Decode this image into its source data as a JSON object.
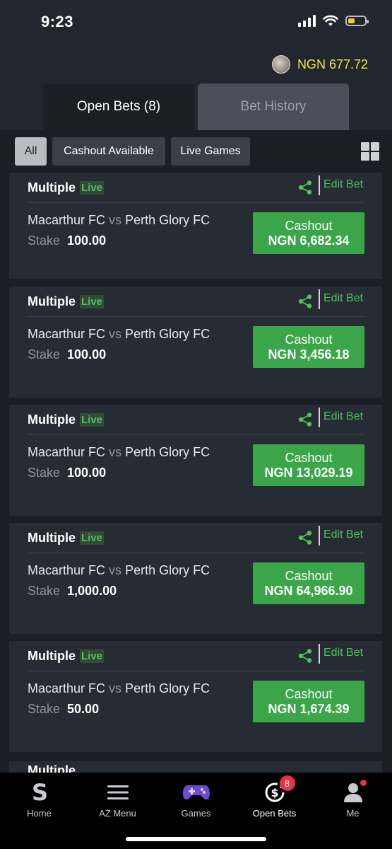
{
  "status": {
    "time": "9:23"
  },
  "header": {
    "balance": "NGN 677.72",
    "tabs": {
      "open_bets": "Open Bets (8)",
      "bet_history": "Bet History"
    }
  },
  "filters": {
    "all": "All",
    "cashout_available": "Cashout Available",
    "live_games": "Live Games"
  },
  "bets": [
    {
      "type": "Multiple",
      "live": "Live",
      "edit": "Edit Bet",
      "home": "Macarthur FC",
      "vs": "vs",
      "away": "Perth Glory FC",
      "stake_label": "Stake",
      "stake": "100.00",
      "cashout_label": "Cashout",
      "cashout_amount": "NGN 6,682.34"
    },
    {
      "type": "Multiple",
      "live": "Live",
      "edit": "Edit Bet",
      "home": "Macarthur FC",
      "vs": "vs",
      "away": "Perth Glory FC",
      "stake_label": "Stake",
      "stake": "100.00",
      "cashout_label": "Cashout",
      "cashout_amount": "NGN 3,456.18"
    },
    {
      "type": "Multiple",
      "live": "Live",
      "edit": "Edit Bet",
      "home": "Macarthur FC",
      "vs": "vs",
      "away": "Perth Glory FC",
      "stake_label": "Stake",
      "stake": "100.00",
      "cashout_label": "Cashout",
      "cashout_amount": "NGN 13,029.19"
    },
    {
      "type": "Multiple",
      "live": "Live",
      "edit": "Edit Bet",
      "home": "Macarthur FC",
      "vs": "vs",
      "away": "Perth Glory FC",
      "stake_label": "Stake",
      "stake": "1,000.00",
      "cashout_label": "Cashout",
      "cashout_amount": "NGN 64,966.90"
    },
    {
      "type": "Multiple",
      "live": "Live",
      "edit": "Edit Bet",
      "home": "Macarthur FC",
      "vs": "vs",
      "away": "Perth Glory FC",
      "stake_label": "Stake",
      "stake": "50.00",
      "cashout_label": "Cashout",
      "cashout_amount": "NGN 1,674.39"
    }
  ],
  "partial_card": {
    "type": "Multiple"
  },
  "nav": {
    "home": "Home",
    "az_menu": "AZ Menu",
    "games": "Games",
    "open_bets": "Open Bets",
    "open_bets_badge": "8",
    "me": "Me"
  },
  "colors": {
    "accent_green": "#3aa649",
    "balance_yellow": "#f6e443",
    "badge_red": "#e7343f",
    "games_purple": "#6c4bd1"
  }
}
